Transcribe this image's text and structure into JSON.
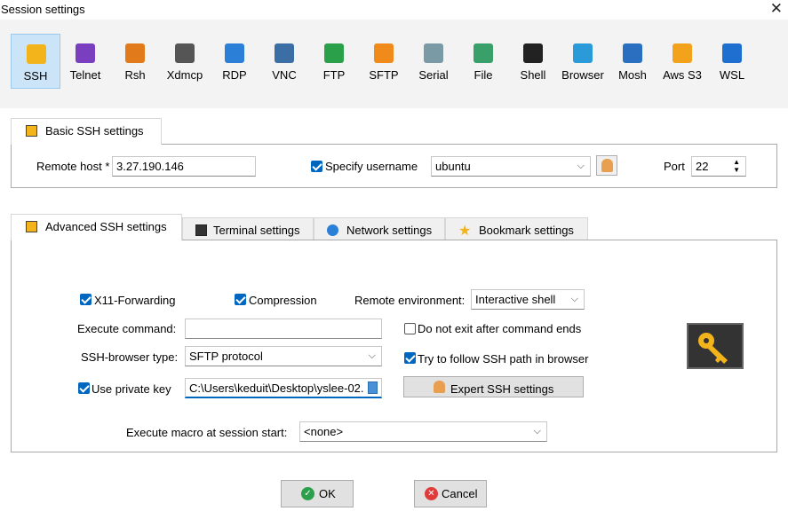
{
  "window": {
    "title": "Session settings",
    "close": "✕"
  },
  "protocols": [
    {
      "label": "SSH",
      "color": "#f2b31b"
    },
    {
      "label": "Telnet",
      "color": "#7a3fbf"
    },
    {
      "label": "Rsh",
      "color": "#e07a1a"
    },
    {
      "label": "Xdmcp",
      "color": "#555555"
    },
    {
      "label": "RDP",
      "color": "#2b7fd6"
    },
    {
      "label": "VNC",
      "color": "#3a6ea5"
    },
    {
      "label": "FTP",
      "color": "#2aa04a"
    },
    {
      "label": "SFTP",
      "color": "#f08a1a"
    },
    {
      "label": "Serial",
      "color": "#7a9aa5"
    },
    {
      "label": "File",
      "color": "#3aa06a"
    },
    {
      "label": "Shell",
      "color": "#222222"
    },
    {
      "label": "Browser",
      "color": "#2a9ad8"
    },
    {
      "label": "Mosh",
      "color": "#2a6fc0"
    },
    {
      "label": "Aws S3",
      "color": "#f2a21b"
    },
    {
      "label": "WSL",
      "color": "#1f6fd0"
    }
  ],
  "basic": {
    "tab_label": "Basic SSH settings",
    "remote_host_label": "Remote host *",
    "remote_host_value": "3.27.190.146",
    "specify_username_label": "Specify username",
    "username_value": "ubuntu",
    "port_label": "Port",
    "port_value": "22"
  },
  "tabs": {
    "advanced": "Advanced SSH settings",
    "terminal": "Terminal settings",
    "network": "Network settings",
    "bookmark": "Bookmark settings"
  },
  "advanced": {
    "x11_label": "X11-Forwarding",
    "compression_label": "Compression",
    "remote_env_label": "Remote environment:",
    "remote_env_value": "Interactive shell",
    "execute_command_label": "Execute command:",
    "execute_command_value": "",
    "no_exit_label": "Do not exit after command ends",
    "ssh_browser_label": "SSH-browser type:",
    "ssh_browser_value": "SFTP protocol",
    "follow_path_label": "Try to follow SSH path in browser",
    "private_key_label": "Use private key",
    "private_key_value": "C:\\Users\\keduit\\Desktop\\yslee-02.",
    "expert_button": "Expert SSH settings",
    "macro_label": "Execute macro at session start:",
    "macro_value": "<none>"
  },
  "buttons": {
    "ok": "OK",
    "cancel": "Cancel"
  }
}
